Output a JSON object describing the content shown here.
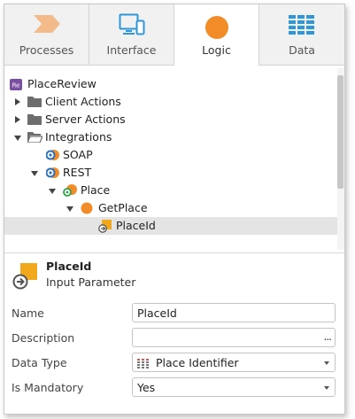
{
  "tabs": [
    {
      "label": "Processes",
      "icon": "processes-chevron-icon"
    },
    {
      "label": "Interface",
      "icon": "interface-monitor-icon"
    },
    {
      "label": "Logic",
      "icon": "logic-circle-icon"
    },
    {
      "label": "Data",
      "icon": "data-grid-icon"
    }
  ],
  "active_tab": "Logic",
  "tree": {
    "root": "PlaceReview",
    "client_actions": "Client Actions",
    "server_actions": "Server Actions",
    "integrations": "Integrations",
    "soap": "SOAP",
    "rest": "REST",
    "place": "Place",
    "getplace": "GetPlace",
    "placeid": "PlaceId"
  },
  "properties": {
    "title": "PlaceId",
    "subtitle": "Input Parameter",
    "rows": {
      "name": {
        "label": "Name",
        "value": "PlaceId"
      },
      "description": {
        "label": "Description",
        "value": "",
        "button": "..."
      },
      "data_type": {
        "label": "Data Type",
        "value": "Place Identifier"
      },
      "is_mandatory": {
        "label": "Is Mandatory",
        "value": "Yes"
      }
    }
  },
  "colors": {
    "accent_orange": "#f28c28",
    "tab_icon_blue": "#2f97d8",
    "processes_icon": "#f3bb8a",
    "module_badge": "#7a4fa2"
  }
}
